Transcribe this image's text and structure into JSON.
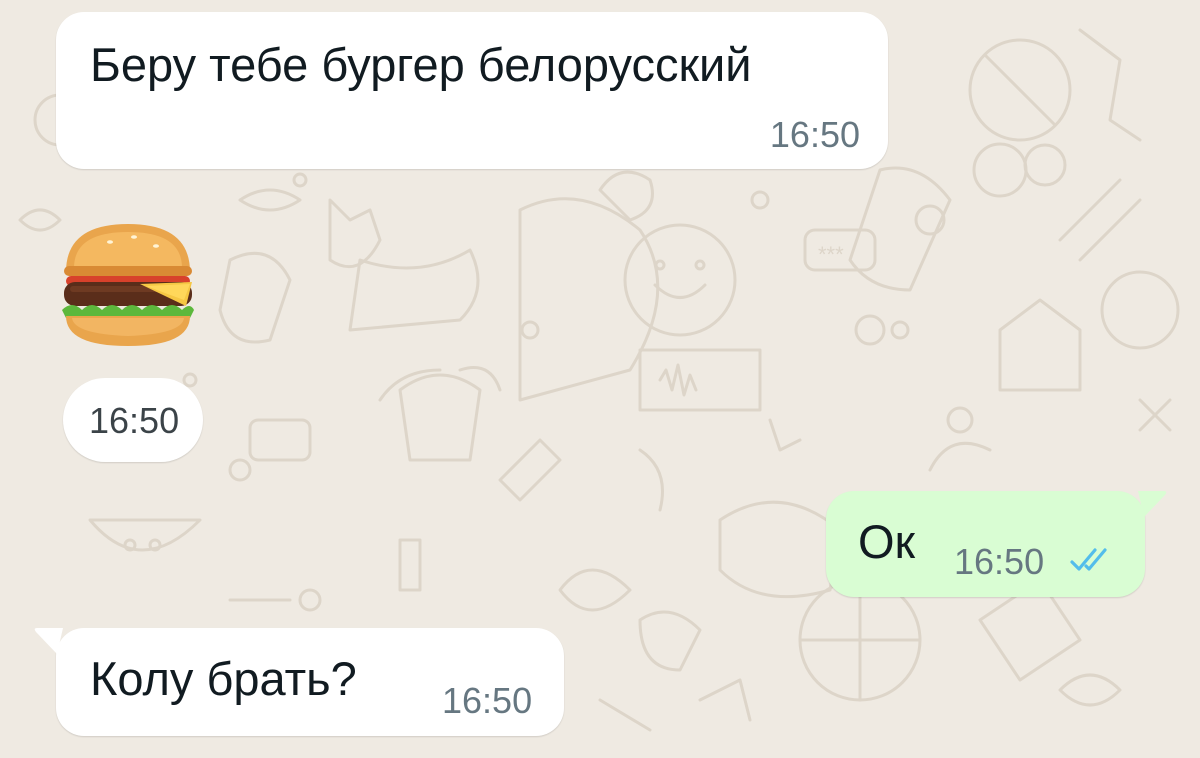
{
  "colors": {
    "chat_background": "#efeae2",
    "incoming_bubble": "#ffffff",
    "outgoing_bubble": "#d9fdd3",
    "read_ticks": "#53bdeb",
    "text": "#111b21",
    "timestamp": "#667781"
  },
  "messages": [
    {
      "direction": "incoming",
      "text": "Беру тебе бургер белорусский",
      "time": "16:50"
    },
    {
      "direction": "incoming",
      "sticker": "hamburger-emoji",
      "time": "16:50"
    },
    {
      "direction": "outgoing",
      "text": "Ок",
      "time": "16:50",
      "status": "read",
      "status_icon": "double-check-icon"
    },
    {
      "direction": "incoming",
      "text": "Колу брать?",
      "time": "16:50"
    }
  ]
}
